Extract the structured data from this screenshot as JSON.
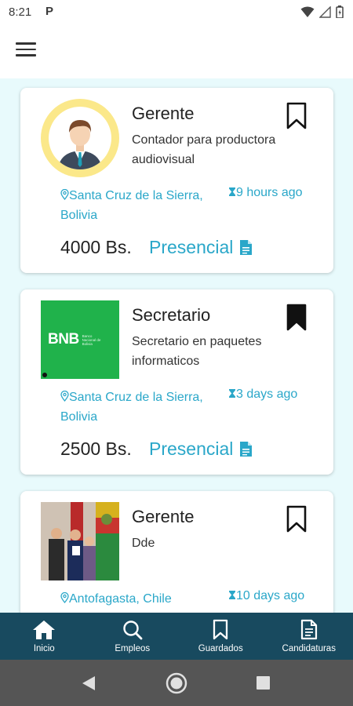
{
  "status": {
    "time": "8:21",
    "carrier_glyph": "P"
  },
  "jobs": [
    {
      "title": "Gerente",
      "description": "Contador para productora audiovisual",
      "location": "Santa Cruz de la Sierra, Bolivia",
      "posted": "9 hours ago",
      "salary": "4000 Bs.",
      "modality": "Presencial",
      "saved": false,
      "logo": "avatar-placeholder"
    },
    {
      "title": "Secretario",
      "description": "Secretario en paquetes informaticos",
      "location": "Santa Cruz de la Sierra, Bolivia",
      "posted": "3 days ago",
      "salary": "2500 Bs.",
      "modality": "Presencial",
      "saved": true,
      "logo": "bnb-logo",
      "logo_text": "BNB",
      "logo_subtext": "Banco Nacional de Bolivia"
    },
    {
      "title": "Gerente",
      "description": "Dde",
      "location": "Antofagasta, Chile",
      "posted": "10 days ago",
      "saved": false,
      "logo": "photo"
    }
  ],
  "nav": [
    {
      "label": "Inicio",
      "icon": "home-icon"
    },
    {
      "label": "Empleos",
      "icon": "search-icon"
    },
    {
      "label": "Guardados",
      "icon": "bookmark-icon"
    },
    {
      "label": "Candidaturas",
      "icon": "document-icon"
    }
  ],
  "colors": {
    "accent": "#2aa7c9",
    "nav_bg": "#184a5f",
    "content_bg": "#e8fafc",
    "bnb_green": "#20b24b"
  }
}
